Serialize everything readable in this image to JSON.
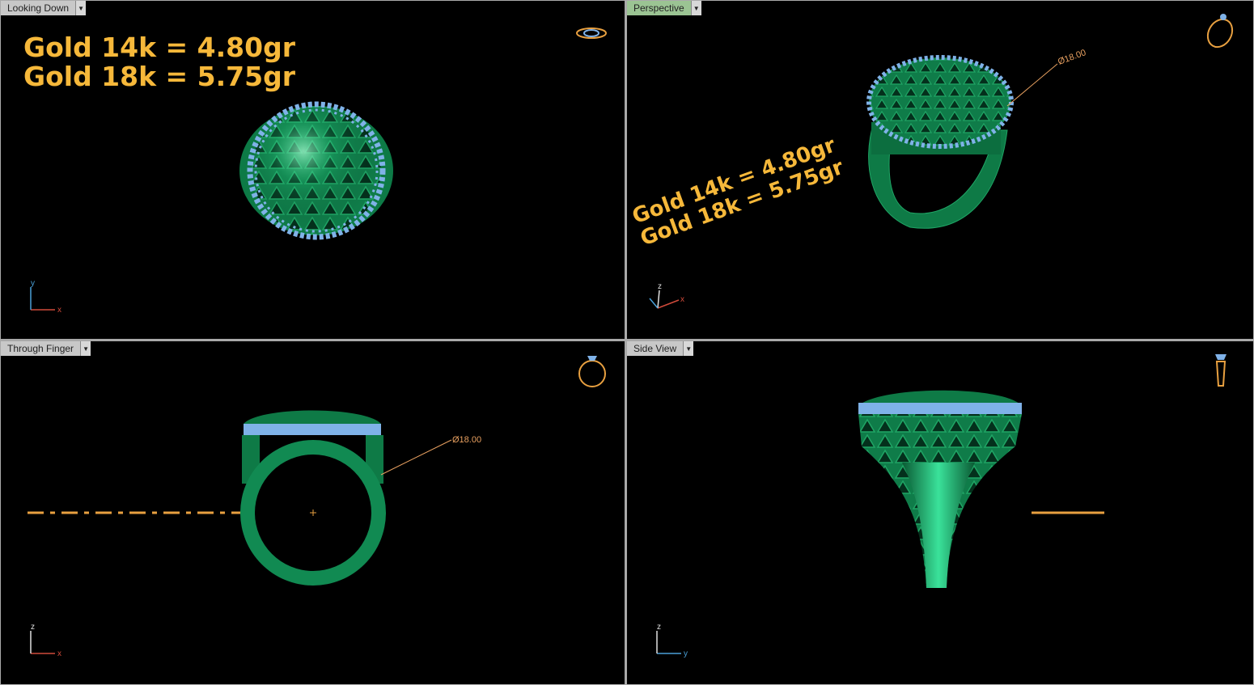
{
  "viewports": [
    {
      "title": "Looking Down",
      "active": false,
      "axes": [
        "y",
        "x"
      ]
    },
    {
      "title": "Perspective",
      "active": true,
      "axes": [
        "z",
        "x"
      ]
    },
    {
      "title": "Through Finger",
      "active": false,
      "axes": [
        "z",
        "x"
      ]
    },
    {
      "title": "Side View",
      "active": false,
      "axes": [
        "z",
        "y"
      ]
    }
  ],
  "weights": {
    "line1": "Gold 14k = 4.80gr",
    "line2": "Gold 18k = 5.75gr"
  },
  "dimension_label": "Ø18.00",
  "colors": {
    "metal": "#118a52",
    "gem": "#7fb2e8",
    "annotation": "#f6b83a",
    "active_tab": "#9bc493",
    "axis_x": "#d04a3a",
    "axis_y": "#4aa0d8",
    "axis_z": "#e0e0e0"
  },
  "icons": [
    "view-cube-ring-icon",
    "dropdown-arrow-icon"
  ]
}
